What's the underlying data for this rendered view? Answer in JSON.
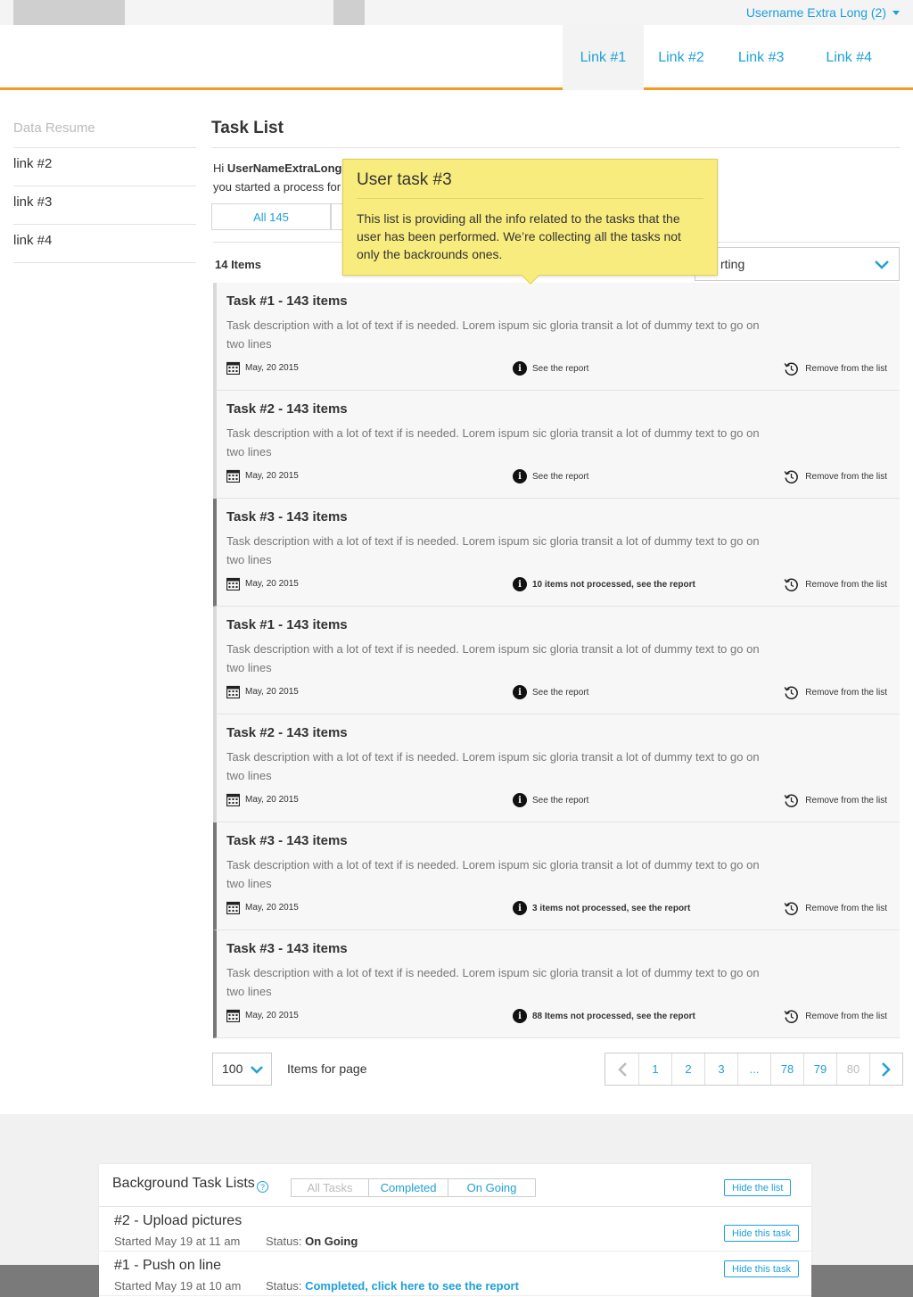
{
  "topbar": {
    "username": "Username Extra Long (2)"
  },
  "nav": {
    "links": [
      "Link #1",
      "Link #2",
      "Link #3",
      "Link #4"
    ]
  },
  "sidebar": {
    "title": "Data Resume",
    "items": [
      "link #2",
      "link #3",
      "link #4"
    ]
  },
  "main": {
    "title": "Task List",
    "greeting_prefix": "Hi ",
    "greeting_user": "UserNameExtraLong,",
    "greeting_line2": "you started a process for",
    "filter_tab": "All 145",
    "items_count": "14 Items",
    "sort_label": "rting"
  },
  "tooltip": {
    "title": "User task #3",
    "body": "This list is providing all the info related to the tasks that the user has been performed. We’re collecting all the tasks not only the backrounds ones."
  },
  "tasks": [
    {
      "title": "Task #1 - 143 items",
      "desc": "Task description with a lot of text if is needed. Lorem ispum sic gloria transit a lot of dummy text to go on two lines",
      "date": "May, 20 2015",
      "report": "See the report",
      "remove": "Remove from the list",
      "warning": false
    },
    {
      "title": "Task #2 - 143 items",
      "desc": "Task description with a lot of text if is needed. Lorem ispum sic gloria transit a lot of dummy text to go on two lines",
      "date": "May, 20 2015",
      "report": "See the report",
      "remove": "Remove from the list",
      "warning": false
    },
    {
      "title": "Task #3 - 143 items",
      "desc": "Task description with a lot of text if is needed. Lorem ispum sic gloria transit a lot of dummy text to go on two lines",
      "date": "May, 20 2015",
      "report": "10 items not processed, see the report",
      "remove": "Remove from the list",
      "warning": true
    },
    {
      "title": "Task #1 - 143 items",
      "desc": "Task description with a lot of text if is needed. Lorem ispum sic gloria transit a lot of dummy text to go on two lines",
      "date": "May, 20 2015",
      "report": "See the report",
      "remove": "Remove from the list",
      "warning": false
    },
    {
      "title": "Task #2 - 143 items",
      "desc": "Task description with a lot of text if is needed. Lorem ispum sic gloria transit a lot of dummy text to go on two lines",
      "date": "May, 20 2015",
      "report": "See the report",
      "remove": "Remove from the list",
      "warning": false
    },
    {
      "title": "Task #3 - 143 items",
      "desc": "Task description with a lot of text if is needed. Lorem ispum sic gloria transit a lot of dummy text to go on two lines",
      "date": "May, 20 2015",
      "report": "3 items not processed, see the report",
      "remove": "Remove from the list",
      "warning": true
    },
    {
      "title": "Task #3 - 143 items",
      "desc": "Task description with a lot of text if is needed. Lorem ispum sic gloria transit a lot of dummy text to go on two lines",
      "date": "May, 20 2015",
      "report": "88 Items not processed, see the report",
      "remove": "Remove from the list",
      "warning": true
    }
  ],
  "pagination": {
    "per_page": "100",
    "per_page_label": "Items for page",
    "pages": [
      "1",
      "2",
      "3",
      "...",
      "78",
      "79",
      "80"
    ]
  },
  "background": {
    "title": "Background Task Lists",
    "help": "?",
    "tabs": [
      "All Tasks",
      "Completed",
      "On Going"
    ],
    "hide_list": "Hide the list",
    "rows": [
      {
        "title": "#2 - Upload pictures",
        "started": "Started May 19 at 11 am",
        "status_label": "Status: ",
        "status": "On Going",
        "link": false,
        "hide": "Hide this task"
      },
      {
        "title": "#1 - Push on line",
        "started": "Started May 19 at 10 am",
        "status_label": "Status: ",
        "status": "Completed, click here to see the report",
        "link": true,
        "hide": "Hide this task"
      }
    ]
  },
  "colors": {
    "accent": "#1ea0d8",
    "header_border": "#f39c1f",
    "tooltip_bg": "#f8ec7e"
  },
  "icons": {
    "date": "calendar-icon",
    "report": "info-icon",
    "remove": "history-icon",
    "expand": "chevron-down-icon"
  }
}
